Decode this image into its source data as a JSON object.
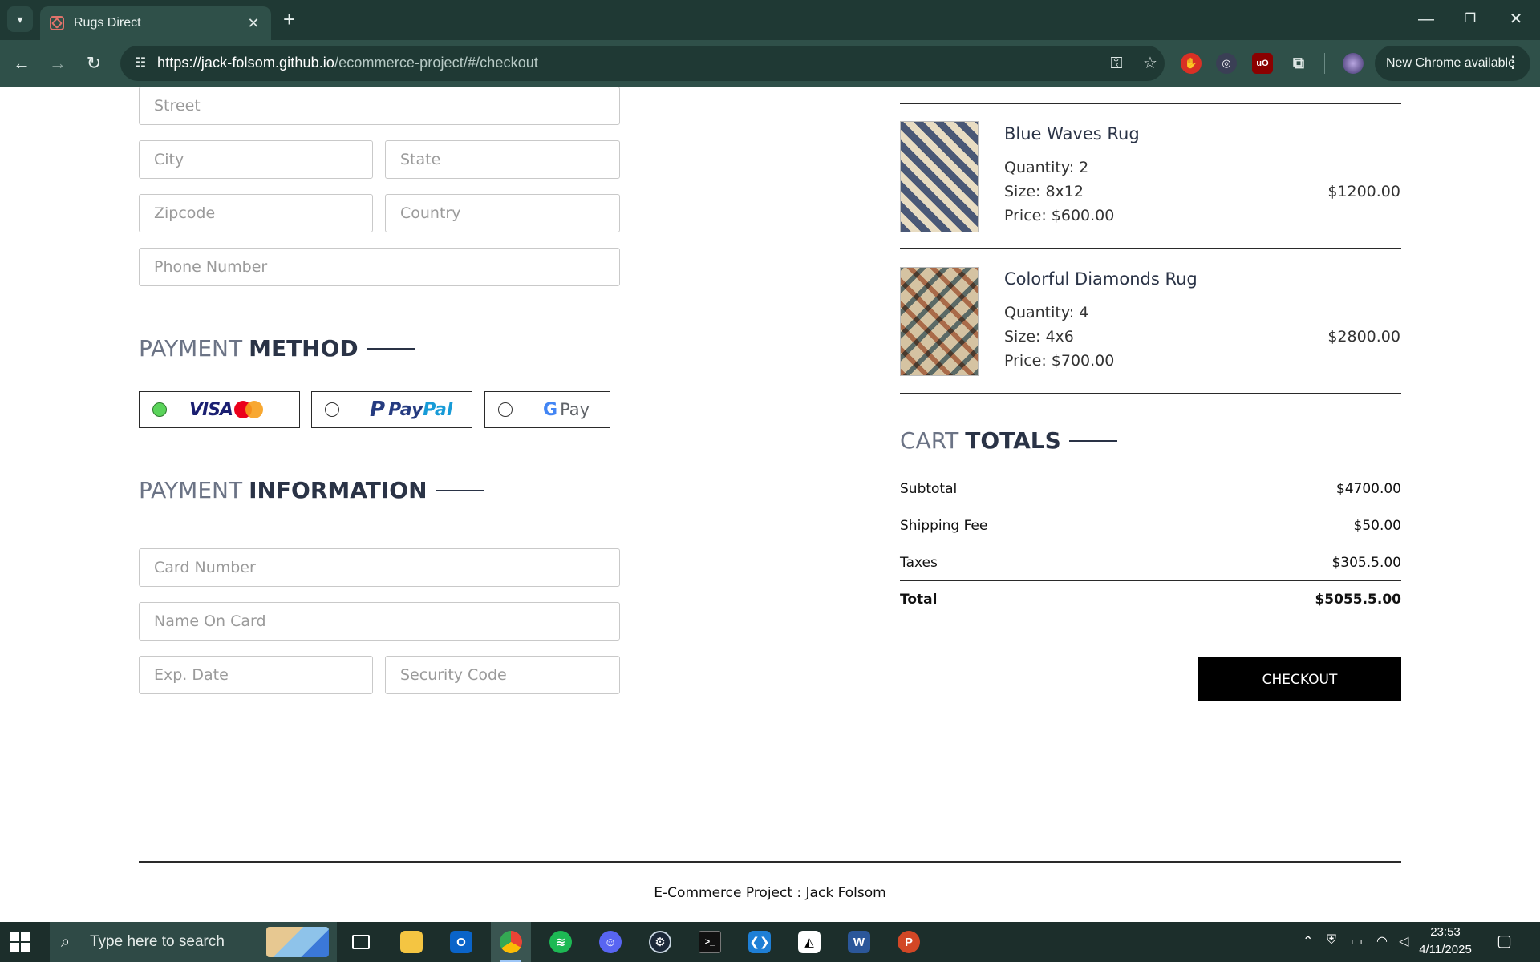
{
  "browser": {
    "tab_title": "Rugs Direct",
    "url_host": "https://jack-folsom.github.io",
    "url_path": "/ecommerce-project/#/checkout",
    "new_chrome_label": "New Chrome available"
  },
  "address_form": {
    "street_placeholder": "Street",
    "city_placeholder": "City",
    "state_placeholder": "State",
    "zipcode_placeholder": "Zipcode",
    "country_placeholder": "Country",
    "phone_placeholder": "Phone Number"
  },
  "payment_method": {
    "title_light": "PAYMENT",
    "title_bold": "METHOD",
    "options": [
      {
        "name": "Visa / MasterCard",
        "visa_label": "VISA",
        "selected": true
      },
      {
        "name": "PayPal",
        "p_label": "P",
        "label_a": "Pay",
        "label_b": "Pal",
        "selected": false
      },
      {
        "name": "Google Pay",
        "g_label": "G",
        "label": "Pay",
        "selected": false
      }
    ]
  },
  "payment_info": {
    "title_light": "PAYMENT",
    "title_bold": "INFORMATION",
    "card_number_placeholder": "Card Number",
    "name_on_card_placeholder": "Name On Card",
    "exp_date_placeholder": "Exp. Date",
    "security_code_placeholder": "Security Code"
  },
  "cart_items": [
    {
      "name": "Blue Waves Rug",
      "quantity": "Quantity: 2",
      "size": "Size: 8x12",
      "price": "Price: $600.00",
      "total": "$1200.00"
    },
    {
      "name": "Colorful Diamonds Rug",
      "quantity": "Quantity: 4",
      "size": "Size: 4x6",
      "price": "Price: $700.00",
      "total": "$2800.00"
    }
  ],
  "cart_totals": {
    "title_light": "CART",
    "title_bold": "TOTALS",
    "rows": [
      {
        "label": "Subtotal",
        "value": "$4700.00"
      },
      {
        "label": "Shipping Fee",
        "value": "$50.00"
      },
      {
        "label": "Taxes",
        "value": "$305.5.00"
      },
      {
        "label": "Total",
        "value": "$5055.5.00"
      }
    ],
    "checkout_label": "CHECKOUT"
  },
  "footer": {
    "text": "E-Commerce Project : Jack Folsom"
  },
  "taskbar": {
    "search_placeholder": "Type here to search",
    "time": "23:53",
    "date": "4/11/2025"
  },
  "colors": {
    "browser_frame": "#1f3934",
    "toolbar": "#2f5049",
    "heading_dark": "#2a3346",
    "heading_light": "#6b7385",
    "checkout_bg": "#000000",
    "radio_selected": "#5ad35a"
  }
}
